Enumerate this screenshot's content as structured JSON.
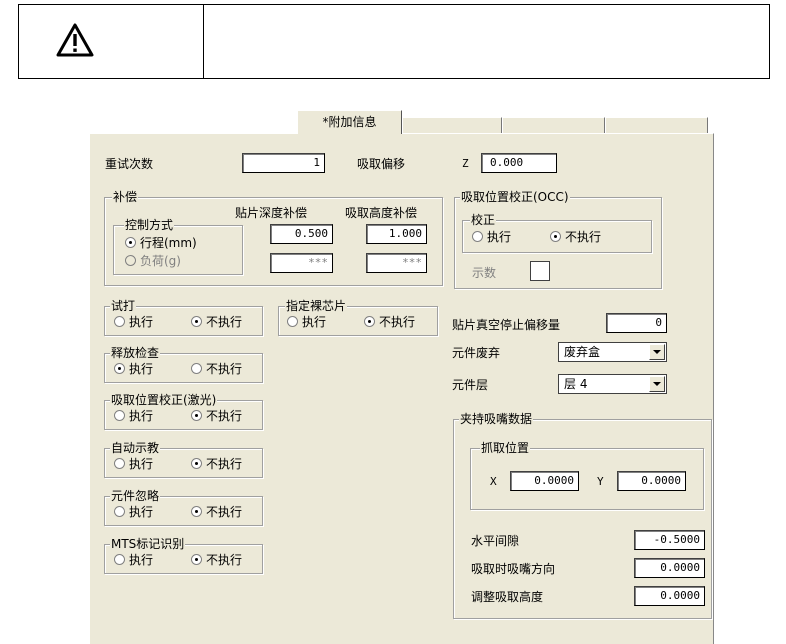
{
  "active_tab": "*附加信息",
  "retry": {
    "label": "重试次数",
    "value": "1"
  },
  "pick_offset": {
    "label": "吸取偏移",
    "axis": "Z",
    "value": "0.000"
  },
  "comp": {
    "title": "补偿",
    "depth_label": "贴片深度补偿",
    "height_label": "吸取高度补偿",
    "control_title": "控制方式",
    "opt_stroke": "行程(mm)",
    "opt_load": "负荷(g)",
    "depth_value": "0.500",
    "height_value": "1.000",
    "depth_load_value": "***",
    "height_load_value": "***"
  },
  "occ": {
    "title": "吸取位置校正(OCC)",
    "correct_title": "校正",
    "exec": "执行",
    "noexec": "不执行",
    "teach_label": "示数"
  },
  "trial": {
    "title": "试打",
    "exec": "执行",
    "noexec": "不执行"
  },
  "die": {
    "title": "指定裸芯片",
    "exec": "执行",
    "noexec": "不执行"
  },
  "release": {
    "title": "释放检查",
    "exec": "执行",
    "noexec": "不执行"
  },
  "laser": {
    "title": "吸取位置校正(激光)",
    "exec": "执行",
    "noexec": "不执行"
  },
  "auto_teach": {
    "title": "自动示教",
    "exec": "执行",
    "noexec": "不执行"
  },
  "ignore": {
    "title": "元件忽略",
    "exec": "执行",
    "noexec": "不执行"
  },
  "mts": {
    "title": "MTS标记识别",
    "exec": "执行",
    "noexec": "不执行"
  },
  "vacuum": {
    "label": "贴片真空停止偏移量",
    "value": "0"
  },
  "discard": {
    "label": "元件废弃",
    "value": "废弃盒"
  },
  "layer": {
    "label": "元件层",
    "value": "层 4"
  },
  "gripper": {
    "title": "夹持吸嘴数据",
    "grab_title": "抓取位置",
    "x_label": "X",
    "x_value": "0.0000",
    "y_label": "Y",
    "y_value": "0.0000",
    "gap_label": "水平间隙",
    "gap_value": "-0.5000",
    "dir_label": "吸取时吸嘴方向",
    "dir_value": "0.0000",
    "adj_label": "调整吸取高度",
    "adj_value": "0.0000"
  }
}
